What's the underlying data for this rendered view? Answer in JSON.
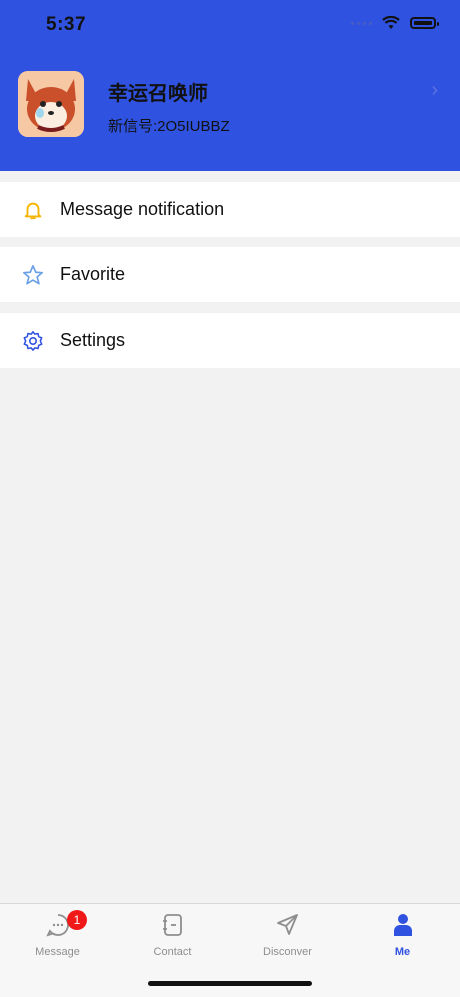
{
  "status": {
    "time": "5:37"
  },
  "profile": {
    "name": "幸运召唤师",
    "uid": "新信号:2O5IUBBZ"
  },
  "menu": [
    {
      "label": "Message notification",
      "icon": "bell-icon",
      "color": "#f5b400"
    },
    {
      "label": "Favorite",
      "icon": "star-icon",
      "color": "#6aa0e6"
    },
    {
      "label": "Settings",
      "icon": "gear-icon",
      "color": "#2f52e0"
    }
  ],
  "tabs": [
    {
      "label": "Message",
      "icon": "chat-icon",
      "badge": "1",
      "active": false
    },
    {
      "label": "Contact",
      "icon": "contact-book-icon",
      "active": false
    },
    {
      "label": "Disconver",
      "icon": "send-icon",
      "active": false
    },
    {
      "label": "Me",
      "icon": "person-icon",
      "active": true
    }
  ],
  "colors": {
    "header": "#2f52e0",
    "accent": "#2f52e0",
    "badge": "#f01818"
  }
}
